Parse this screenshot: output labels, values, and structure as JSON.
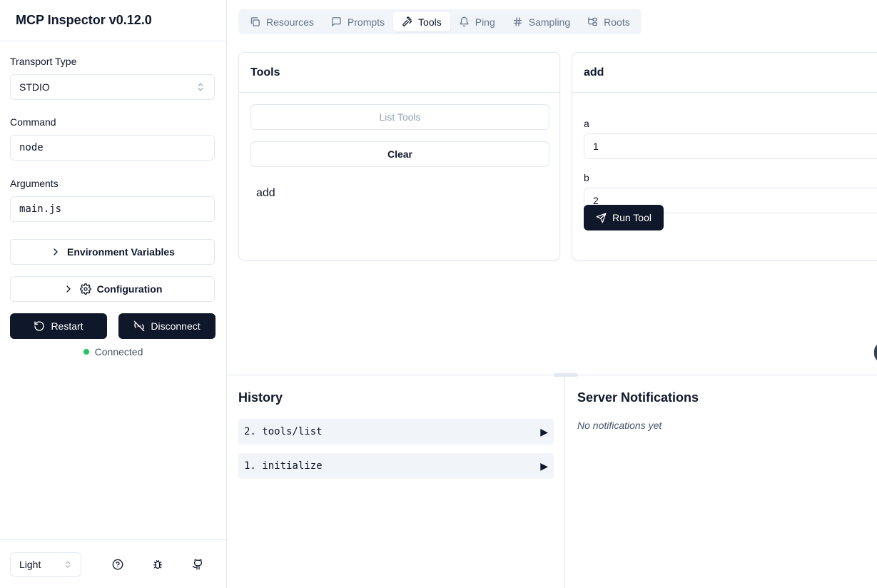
{
  "app": {
    "title": "MCP Inspector v0.12.0"
  },
  "sidebar": {
    "transport_label": "Transport Type",
    "transport_value": "STDIO",
    "command_label": "Command",
    "command_value": "node",
    "arguments_label": "Arguments",
    "arguments_value": "main.js",
    "env_button": "Environment Variables",
    "config_button": "Configuration",
    "restart_button": "Restart",
    "disconnect_button": "Disconnect",
    "status_text": "Connected",
    "status_color": "#22c55e",
    "theme_value": "Light",
    "footer_icons": [
      "help-circle-icon",
      "bug-icon",
      "github-icon"
    ]
  },
  "tabs": [
    {
      "label": "Resources",
      "icon": "files-icon"
    },
    {
      "label": "Prompts",
      "icon": "message-square-icon"
    },
    {
      "label": "Tools",
      "icon": "hammer-icon",
      "active": true
    },
    {
      "label": "Ping",
      "icon": "bell-icon"
    },
    {
      "label": "Sampling",
      "icon": "hash-icon"
    },
    {
      "label": "Roots",
      "icon": "folder-tree-icon"
    }
  ],
  "tools_panel": {
    "title": "Tools",
    "list_button": "List Tools",
    "clear_button": "Clear",
    "items": [
      "add"
    ]
  },
  "tool_detail": {
    "title": "add",
    "params": [
      {
        "name": "a",
        "value": "1"
      },
      {
        "name": "b",
        "value": "2"
      }
    ],
    "run_button": "Run Tool"
  },
  "history": {
    "title": "History",
    "items": [
      "2. tools/list",
      "1. initialize"
    ],
    "expand_glyph": "▶"
  },
  "notifications": {
    "title": "Server Notifications",
    "empty_text": "No notifications yet"
  },
  "colors": {
    "primary": "#0f172a",
    "border": "#e2e8f0",
    "muted_bg": "#f1f5f9",
    "muted_text": "#64748b"
  }
}
